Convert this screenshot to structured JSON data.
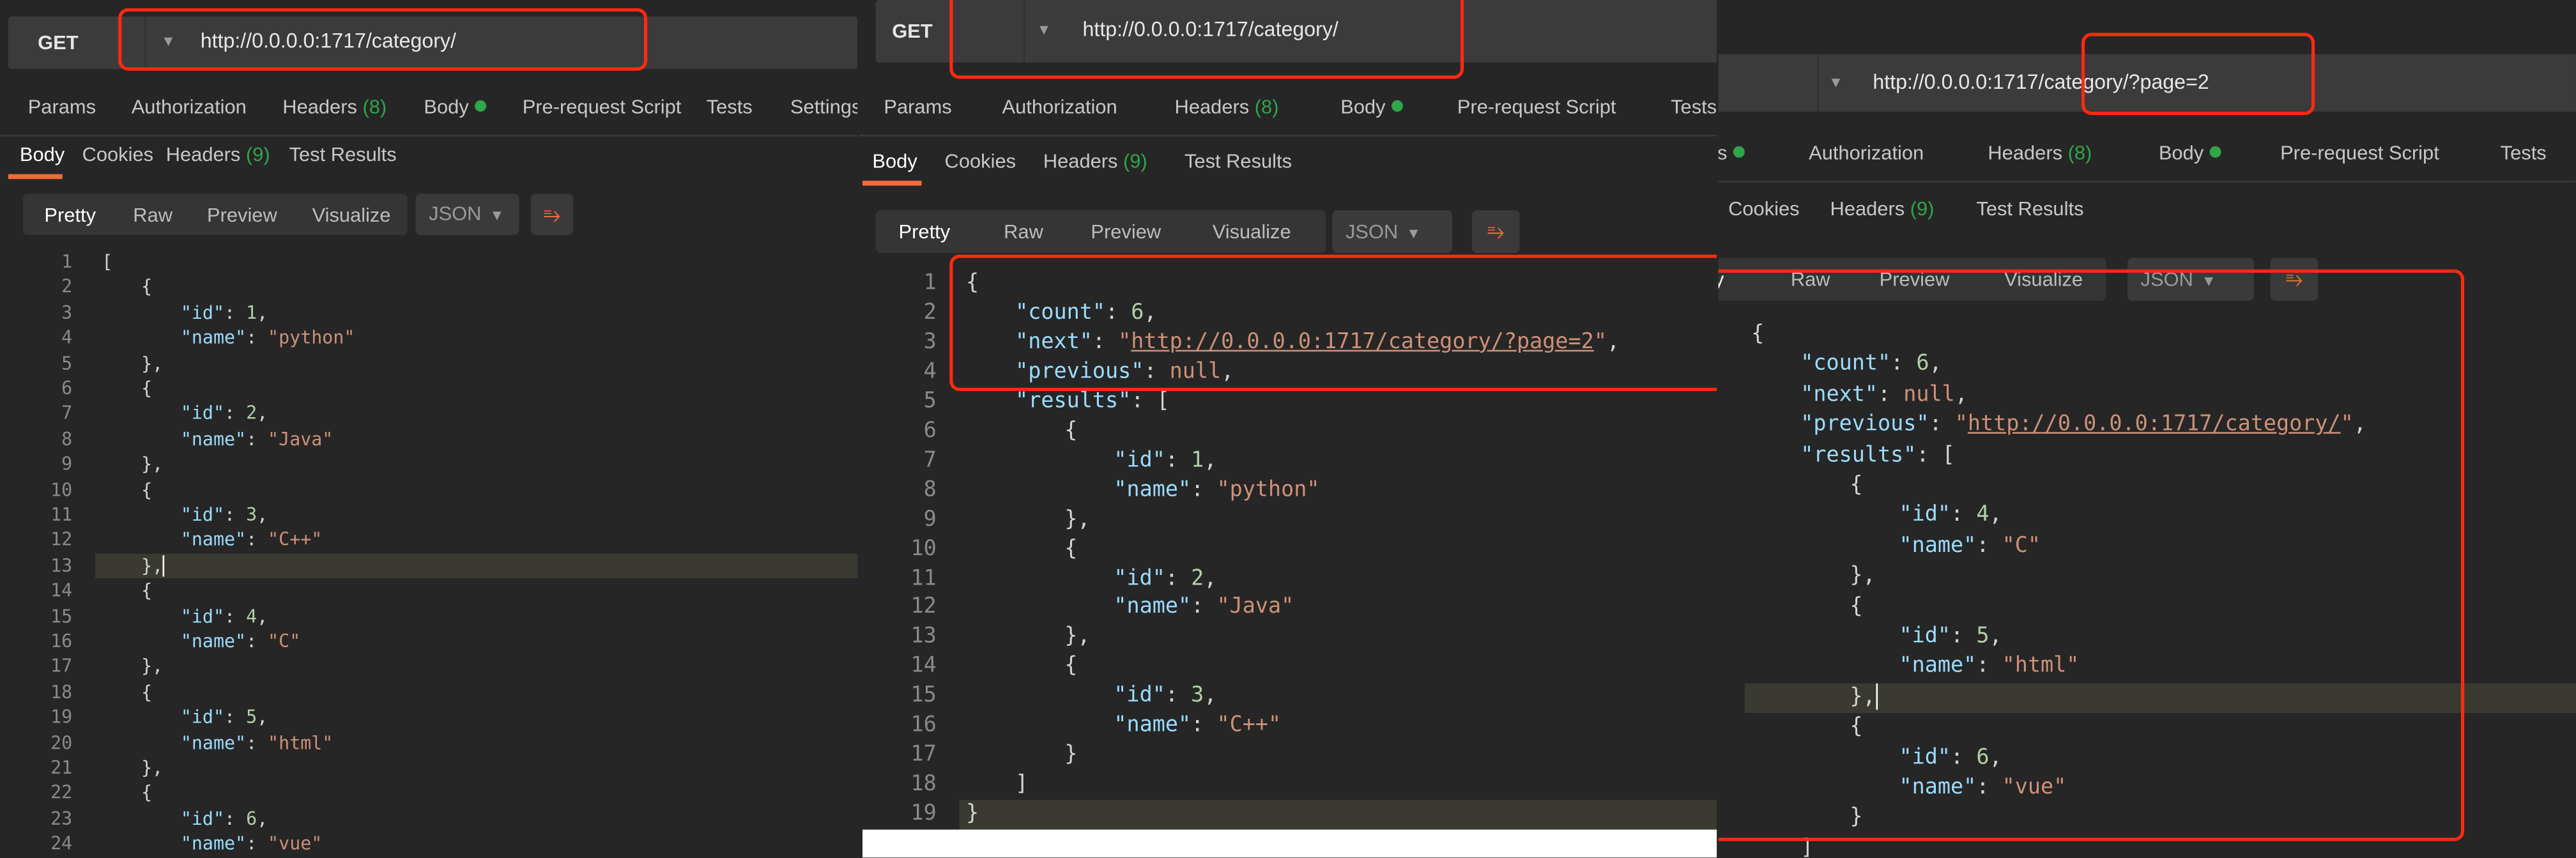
{
  "colors": {
    "accent": "#f26b3a",
    "status_green": "#2fa64a",
    "annotation_red": "#ff2a10",
    "key": "#9cdcfe",
    "string": "#ce9178",
    "number": "#b5cea8"
  },
  "panels": [
    {
      "method": "GET",
      "url": "http://0.0.0.0:1717/category/",
      "request_tabs": [
        {
          "label": "Params"
        },
        {
          "label": "Authorization"
        },
        {
          "label": "Headers",
          "count": "(8)"
        },
        {
          "label": "Body",
          "dot": true
        },
        {
          "label": "Pre-request Script"
        },
        {
          "label": "Tests"
        },
        {
          "label": "Settings"
        }
      ],
      "response_tabs": [
        {
          "label": "Body",
          "active": true
        },
        {
          "label": "Cookies"
        },
        {
          "label": "Headers",
          "count": "(9)"
        },
        {
          "label": "Test Results"
        }
      ],
      "view_modes": [
        {
          "label": "Pretty",
          "active": true
        },
        {
          "label": "Raw"
        },
        {
          "label": "Preview"
        },
        {
          "label": "Visualize"
        }
      ],
      "format": "JSON",
      "wrap_icon": "wrap-lines-icon",
      "code": [
        {
          "i": 0,
          "t": [
            [
              "p",
              "["
            ]
          ]
        },
        {
          "i": 1,
          "t": [
            [
              "p",
              "{"
            ]
          ]
        },
        {
          "i": 2,
          "t": [
            [
              "k",
              "\"id\""
            ],
            [
              "p",
              ": "
            ],
            [
              "n",
              "1"
            ],
            [
              "p",
              ","
            ]
          ]
        },
        {
          "i": 2,
          "t": [
            [
              "k",
              "\"name\""
            ],
            [
              "p",
              ": "
            ],
            [
              "s",
              "\"python\""
            ]
          ]
        },
        {
          "i": 1,
          "t": [
            [
              "p",
              "},"
            ]
          ]
        },
        {
          "i": 1,
          "t": [
            [
              "p",
              "{"
            ]
          ]
        },
        {
          "i": 2,
          "t": [
            [
              "k",
              "\"id\""
            ],
            [
              "p",
              ": "
            ],
            [
              "n",
              "2"
            ],
            [
              "p",
              ","
            ]
          ]
        },
        {
          "i": 2,
          "t": [
            [
              "k",
              "\"name\""
            ],
            [
              "p",
              ": "
            ],
            [
              "s",
              "\"Java\""
            ]
          ]
        },
        {
          "i": 1,
          "t": [
            [
              "p",
              "},"
            ]
          ]
        },
        {
          "i": 1,
          "t": [
            [
              "p",
              "{"
            ]
          ]
        },
        {
          "i": 2,
          "t": [
            [
              "k",
              "\"id\""
            ],
            [
              "p",
              ": "
            ],
            [
              "n",
              "3"
            ],
            [
              "p",
              ","
            ]
          ]
        },
        {
          "i": 2,
          "t": [
            [
              "k",
              "\"name\""
            ],
            [
              "p",
              ": "
            ],
            [
              "s",
              "\"C++\""
            ]
          ]
        },
        {
          "i": 1,
          "t": [
            [
              "p",
              "},"
            ]
          ],
          "highlight": true,
          "cursor": true
        },
        {
          "i": 1,
          "t": [
            [
              "p",
              "{"
            ]
          ]
        },
        {
          "i": 2,
          "t": [
            [
              "k",
              "\"id\""
            ],
            [
              "p",
              ": "
            ],
            [
              "n",
              "4"
            ],
            [
              "p",
              ","
            ]
          ]
        },
        {
          "i": 2,
          "t": [
            [
              "k",
              "\"name\""
            ],
            [
              "p",
              ": "
            ],
            [
              "s",
              "\"C\""
            ]
          ]
        },
        {
          "i": 1,
          "t": [
            [
              "p",
              "},"
            ]
          ]
        },
        {
          "i": 1,
          "t": [
            [
              "p",
              "{"
            ]
          ]
        },
        {
          "i": 2,
          "t": [
            [
              "k",
              "\"id\""
            ],
            [
              "p",
              ": "
            ],
            [
              "n",
              "5"
            ],
            [
              "p",
              ","
            ]
          ]
        },
        {
          "i": 2,
          "t": [
            [
              "k",
              "\"name\""
            ],
            [
              "p",
              ": "
            ],
            [
              "s",
              "\"html\""
            ]
          ]
        },
        {
          "i": 1,
          "t": [
            [
              "p",
              "},"
            ]
          ]
        },
        {
          "i": 1,
          "t": [
            [
              "p",
              "{"
            ]
          ]
        },
        {
          "i": 2,
          "t": [
            [
              "k",
              "\"id\""
            ],
            [
              "p",
              ": "
            ],
            [
              "n",
              "6"
            ],
            [
              "p",
              ","
            ]
          ]
        },
        {
          "i": 2,
          "t": [
            [
              "k",
              "\"name\""
            ],
            [
              "p",
              ": "
            ],
            [
              "s",
              "\"vue\""
            ]
          ]
        }
      ]
    },
    {
      "method": "GET",
      "url": "http://0.0.0.0:1717/category/",
      "request_tabs": [
        {
          "label": "Params"
        },
        {
          "label": "Authorization"
        },
        {
          "label": "Headers",
          "count": "(8)"
        },
        {
          "label": "Body",
          "dot": true
        },
        {
          "label": "Pre-request Script"
        },
        {
          "label": "Tests"
        }
      ],
      "response_tabs": [
        {
          "label": "Body",
          "active": true
        },
        {
          "label": "Cookies"
        },
        {
          "label": "Headers",
          "count": "(9)"
        },
        {
          "label": "Test Results"
        }
      ],
      "view_modes": [
        {
          "label": "Pretty",
          "active": true
        },
        {
          "label": "Raw"
        },
        {
          "label": "Preview"
        },
        {
          "label": "Visualize"
        }
      ],
      "format": "JSON",
      "wrap_icon": "wrap-lines-icon",
      "code": [
        {
          "i": 0,
          "t": [
            [
              "p",
              "{"
            ]
          ]
        },
        {
          "i": 1,
          "t": [
            [
              "k",
              "\"count\""
            ],
            [
              "p",
              ": "
            ],
            [
              "n",
              "6"
            ],
            [
              "p",
              ","
            ]
          ]
        },
        {
          "i": 1,
          "t": [
            [
              "k",
              "\"next\""
            ],
            [
              "p",
              ": "
            ],
            [
              "s",
              "\""
            ],
            [
              "su",
              "http://0.0.0.0:1717/category/?page=2"
            ],
            [
              "s",
              "\""
            ],
            [
              "p",
              ","
            ]
          ]
        },
        {
          "i": 1,
          "t": [
            [
              "k",
              "\"previous\""
            ],
            [
              "p",
              ": "
            ],
            [
              "nl",
              "null"
            ],
            [
              "p",
              ","
            ]
          ]
        },
        {
          "i": 1,
          "t": [
            [
              "k",
              "\"results\""
            ],
            [
              "p",
              ": ["
            ]
          ]
        },
        {
          "i": 2,
          "t": [
            [
              "p",
              "{"
            ]
          ]
        },
        {
          "i": 3,
          "t": [
            [
              "k",
              "\"id\""
            ],
            [
              "p",
              ": "
            ],
            [
              "n",
              "1"
            ],
            [
              "p",
              ","
            ]
          ]
        },
        {
          "i": 3,
          "t": [
            [
              "k",
              "\"name\""
            ],
            [
              "p",
              ": "
            ],
            [
              "s",
              "\"python\""
            ]
          ]
        },
        {
          "i": 2,
          "t": [
            [
              "p",
              "},"
            ]
          ]
        },
        {
          "i": 2,
          "t": [
            [
              "p",
              "{"
            ]
          ]
        },
        {
          "i": 3,
          "t": [
            [
              "k",
              "\"id\""
            ],
            [
              "p",
              ": "
            ],
            [
              "n",
              "2"
            ],
            [
              "p",
              ","
            ]
          ]
        },
        {
          "i": 3,
          "t": [
            [
              "k",
              "\"name\""
            ],
            [
              "p",
              ": "
            ],
            [
              "s",
              "\"Java\""
            ]
          ]
        },
        {
          "i": 2,
          "t": [
            [
              "p",
              "},"
            ]
          ]
        },
        {
          "i": 2,
          "t": [
            [
              "p",
              "{"
            ]
          ]
        },
        {
          "i": 3,
          "t": [
            [
              "k",
              "\"id\""
            ],
            [
              "p",
              ": "
            ],
            [
              "n",
              "3"
            ],
            [
              "p",
              ","
            ]
          ]
        },
        {
          "i": 3,
          "t": [
            [
              "k",
              "\"name\""
            ],
            [
              "p",
              ": "
            ],
            [
              "s",
              "\"C++\""
            ]
          ]
        },
        {
          "i": 2,
          "t": [
            [
              "p",
              "}"
            ]
          ]
        },
        {
          "i": 1,
          "t": [
            [
              "p",
              "]"
            ]
          ]
        },
        {
          "i": 0,
          "t": [
            [
              "p",
              "}"
            ]
          ],
          "highlight": true
        }
      ]
    },
    {
      "url": "http://0.0.0.0:1717/category/?page=2",
      "request_tabs": [
        {
          "label": "Params",
          "dot": true
        },
        {
          "label": "Authorization"
        },
        {
          "label": "Headers",
          "count": "(8)"
        },
        {
          "label": "Body",
          "dot": true
        },
        {
          "label": "Pre-request Script"
        },
        {
          "label": "Tests"
        }
      ],
      "response_tabs": [
        {
          "label": "Cookies"
        },
        {
          "label": "Headers",
          "count": "(9)"
        },
        {
          "label": "Test Results"
        }
      ],
      "view_modes": [
        {
          "label": "Pretty",
          "active": true
        },
        {
          "label": "Raw"
        },
        {
          "label": "Preview"
        },
        {
          "label": "Visualize"
        }
      ],
      "format": "JSON",
      "wrap_icon": "wrap-lines-icon",
      "code": [
        {
          "i": 0,
          "t": [
            [
              "p",
              "{"
            ]
          ]
        },
        {
          "i": 1,
          "t": [
            [
              "k",
              "\"count\""
            ],
            [
              "p",
              ": "
            ],
            [
              "n",
              "6"
            ],
            [
              "p",
              ","
            ]
          ]
        },
        {
          "i": 1,
          "t": [
            [
              "k",
              "\"next\""
            ],
            [
              "p",
              ": "
            ],
            [
              "nl",
              "null"
            ],
            [
              "p",
              ","
            ]
          ]
        },
        {
          "i": 1,
          "t": [
            [
              "k",
              "\"previous\""
            ],
            [
              "p",
              ": "
            ],
            [
              "s",
              "\""
            ],
            [
              "su",
              "http://0.0.0.0:1717/category/"
            ],
            [
              "s",
              "\""
            ],
            [
              "p",
              ","
            ]
          ]
        },
        {
          "i": 1,
          "t": [
            [
              "k",
              "\"results\""
            ],
            [
              "p",
              ": ["
            ]
          ]
        },
        {
          "i": 2,
          "t": [
            [
              "p",
              "{"
            ]
          ]
        },
        {
          "i": 3,
          "t": [
            [
              "k",
              "\"id\""
            ],
            [
              "p",
              ": "
            ],
            [
              "n",
              "4"
            ],
            [
              "p",
              ","
            ]
          ]
        },
        {
          "i": 3,
          "t": [
            [
              "k",
              "\"name\""
            ],
            [
              "p",
              ": "
            ],
            [
              "s",
              "\"C\""
            ]
          ]
        },
        {
          "i": 2,
          "t": [
            [
              "p",
              "},"
            ]
          ]
        },
        {
          "i": 2,
          "t": [
            [
              "p",
              "{"
            ]
          ]
        },
        {
          "i": 3,
          "t": [
            [
              "k",
              "\"id\""
            ],
            [
              "p",
              ": "
            ],
            [
              "n",
              "5"
            ],
            [
              "p",
              ","
            ]
          ]
        },
        {
          "i": 3,
          "t": [
            [
              "k",
              "\"name\""
            ],
            [
              "p",
              ": "
            ],
            [
              "s",
              "\"html\""
            ]
          ]
        },
        {
          "i": 2,
          "t": [
            [
              "p",
              "},"
            ]
          ],
          "highlight": true,
          "cursor": true
        },
        {
          "i": 2,
          "t": [
            [
              "p",
              "{"
            ]
          ]
        },
        {
          "i": 3,
          "t": [
            [
              "k",
              "\"id\""
            ],
            [
              "p",
              ": "
            ],
            [
              "n",
              "6"
            ],
            [
              "p",
              ","
            ]
          ]
        },
        {
          "i": 3,
          "t": [
            [
              "k",
              "\"name\""
            ],
            [
              "p",
              ": "
            ],
            [
              "s",
              "\"vue\""
            ]
          ]
        },
        {
          "i": 2,
          "t": [
            [
              "p",
              "}"
            ]
          ]
        },
        {
          "i": 1,
          "t": [
            [
              "p",
              "]"
            ]
          ]
        }
      ]
    }
  ]
}
